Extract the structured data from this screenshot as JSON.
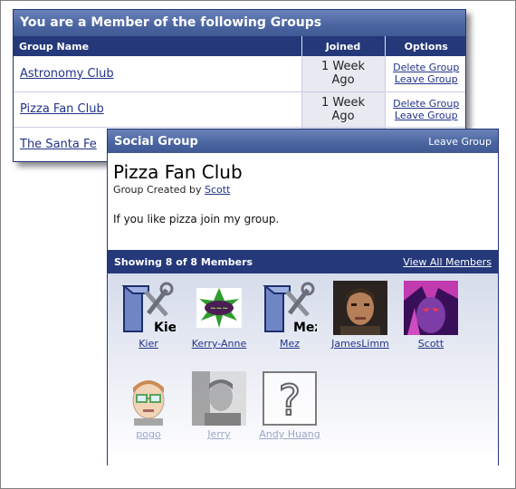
{
  "groups_panel": {
    "title": "You are a Member of the following Groups",
    "columns": {
      "name": "Group Name",
      "joined": "Joined",
      "options": "Options"
    },
    "rows": [
      {
        "name": "Astronomy Club",
        "joined": "1 Week Ago",
        "delete": "Delete Group",
        "leave": "Leave Group"
      },
      {
        "name": "Pizza Fan Club",
        "joined": "1 Week Ago",
        "delete": "Delete Group",
        "leave": "Leave Group"
      },
      {
        "name": "The Santa Fe"
      }
    ]
  },
  "social_panel": {
    "header_title": "Social Group",
    "leave_label": "Leave Group",
    "group_name": "Pizza Fan Club",
    "created_prefix": "Group Created by",
    "creator": "Scott",
    "description": "If you like pizza join my group.",
    "members_summary": "Showing 8 of 8 Members",
    "view_all_label": "View All Members",
    "members": [
      {
        "name": "Kier",
        "icon": "tools-logo-avatar"
      },
      {
        "name": "Kerry-Anne",
        "icon": "cartoon-logo-avatar"
      },
      {
        "name": "Mez",
        "icon": "tools-logo-avatar"
      },
      {
        "name": "JamesLimm",
        "icon": "photo-avatar"
      },
      {
        "name": "Scott",
        "icon": "anime-avatar"
      },
      {
        "name": "pogo",
        "icon": "cartoon-face-avatar"
      },
      {
        "name": "Jerry",
        "icon": "photo-avatar"
      },
      {
        "name": "Andy Huang",
        "icon": "question-mark-avatar"
      }
    ]
  },
  "colors": {
    "header_dark": "#25387a",
    "header_gradient": "#4a64a0",
    "link": "#22338a"
  }
}
